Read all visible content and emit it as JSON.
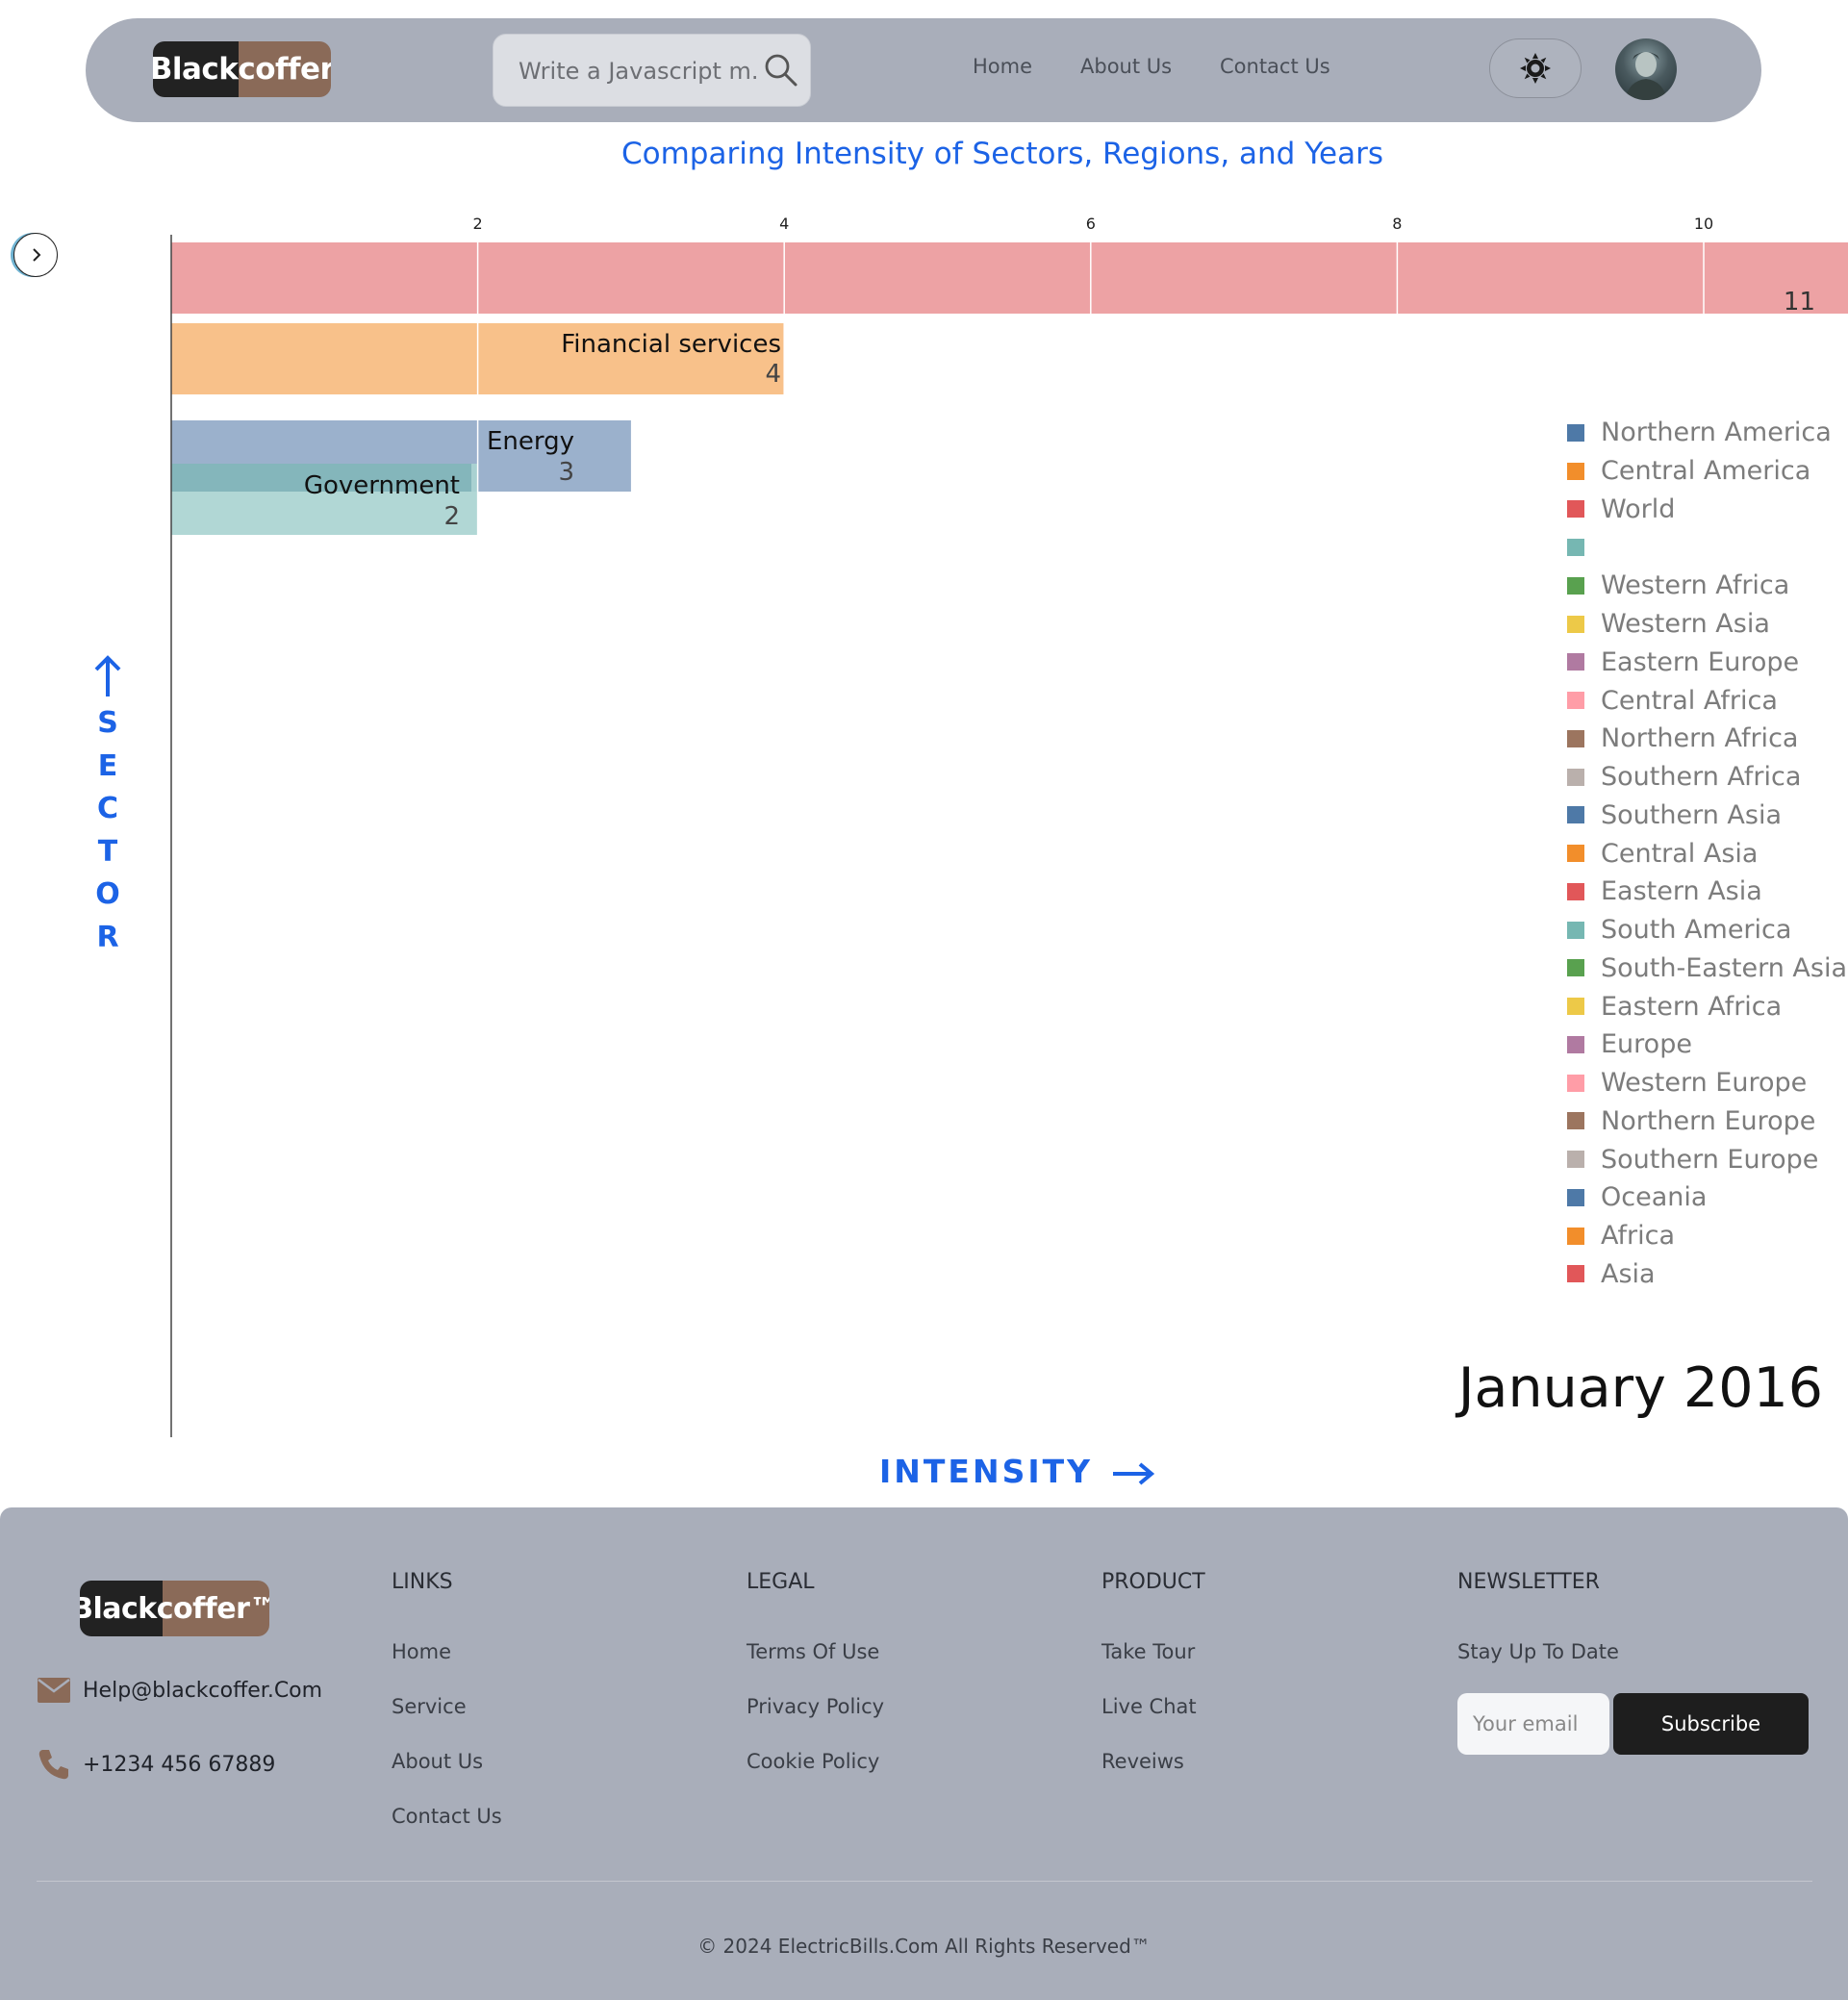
{
  "header": {
    "logo": "Blackcoffer",
    "search_placeholder": "Write a Javascript m...",
    "nav": [
      "Home",
      "About Us",
      "Contact Us"
    ]
  },
  "colors": {
    "header_bg": "#a9aeba",
    "accent": "#1c63e6",
    "logo_dark": "#222222",
    "logo_brown": "#8a6a58"
  },
  "chart_data": {
    "type": "bar",
    "title": "Comparing Intensity of Sectors, Regions, and Years",
    "xlabel": "INTENSITY",
    "ylabel": "SECTOR",
    "period": "January 2016",
    "xlim": [
      0,
      11
    ],
    "ticks": [
      2,
      4,
      6,
      8,
      10
    ],
    "bars": [
      {
        "label": "",
        "value": 11,
        "color": "#ec9a9c"
      },
      {
        "label": "Financial services",
        "value": 4,
        "color": "#f7bc80"
      },
      {
        "label": "Energy",
        "value": 3,
        "color": "#93aac8"
      },
      {
        "label": "Government",
        "value": 2,
        "color": "#aad4d1"
      }
    ],
    "legend": [
      {
        "label": "Northern America",
        "color": "#4e79a7"
      },
      {
        "label": "Central America",
        "color": "#f28e2b"
      },
      {
        "label": "World",
        "color": "#e15759"
      },
      {
        "label": "",
        "color": "#76b7b2"
      },
      {
        "label": "Western Africa",
        "color": "#59a14f"
      },
      {
        "label": "Western Asia",
        "color": "#edc948"
      },
      {
        "label": "Eastern Europe",
        "color": "#b07aa1"
      },
      {
        "label": "Central Africa",
        "color": "#ff9da7"
      },
      {
        "label": "Northern Africa",
        "color": "#9c755f"
      },
      {
        "label": "Southern Africa",
        "color": "#bab0ac"
      },
      {
        "label": "Southern Asia",
        "color": "#4e79a7"
      },
      {
        "label": "Central Asia",
        "color": "#f28e2b"
      },
      {
        "label": "Eastern Asia",
        "color": "#e15759"
      },
      {
        "label": "South America",
        "color": "#76b7b2"
      },
      {
        "label": "South-Eastern Asia",
        "color": "#59a14f"
      },
      {
        "label": "Eastern Africa",
        "color": "#edc948"
      },
      {
        "label": "Europe",
        "color": "#b07aa1"
      },
      {
        "label": "Western Europe",
        "color": "#ff9da7"
      },
      {
        "label": "Northern Europe",
        "color": "#9c755f"
      },
      {
        "label": "Southern Europe",
        "color": "#bab0ac"
      },
      {
        "label": "Oceania",
        "color": "#4e79a7"
      },
      {
        "label": "Africa",
        "color": "#f28e2b"
      },
      {
        "label": "Asia",
        "color": "#e15759"
      }
    ]
  },
  "footer": {
    "logo": "Blackcoffer™",
    "email": "Help@blackcoffer.Com",
    "phone": "+1234 456 67889",
    "columns": [
      {
        "heading": "LINKS",
        "items": [
          "Home",
          "Service",
          "About Us",
          "Contact Us"
        ]
      },
      {
        "heading": "LEGAL",
        "items": [
          "Terms Of Use",
          "Privacy Policy",
          "Cookie Policy"
        ]
      },
      {
        "heading": "PRODUCT",
        "items": [
          "Take Tour",
          "Live Chat",
          "Reveiws"
        ]
      }
    ],
    "newsletter": {
      "heading": "NEWSLETTER",
      "subtitle": "Stay Up To Date",
      "email_placeholder": "Your email",
      "button": "Subscribe"
    },
    "copyright": "© 2024 ElectricBills.Com All Rights Reserved™"
  }
}
